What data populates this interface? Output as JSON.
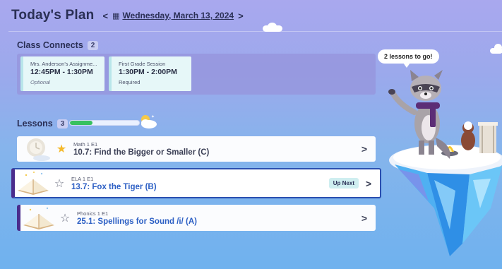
{
  "header": {
    "title": "Today's Plan",
    "prev_glyph": "<",
    "next_glyph": ">",
    "calendar_glyph": "▦",
    "date": "Wednesday, March 13, 2024"
  },
  "class_connects": {
    "title": "Class Connects",
    "count": "2",
    "cards": [
      {
        "who": "Mrs. Anderson's Assignme...",
        "time": "12:45PM - 1:30PM",
        "requirement": "Optional"
      },
      {
        "who": "First Grade Session",
        "time": "1:30PM - 2:00PM",
        "requirement": "Required"
      }
    ]
  },
  "lessons": {
    "title": "Lessons",
    "count": "3",
    "progress_fraction": 0.33,
    "items": [
      {
        "subject": "Math 1 E1",
        "name": "10.7: Find the Bigger or Smaller (C)",
        "star": "★",
        "chevron": ">"
      },
      {
        "subject": "ELA 1 E1",
        "name": "13.7: Fox the Tiger (B)",
        "star": "☆",
        "badge": "Up Next",
        "chevron": ">"
      },
      {
        "subject": "Phonics 1 E1",
        "name": "25.1: Spellings for Sound /i/ (A)",
        "star": "☆",
        "chevron": ">"
      }
    ]
  },
  "mascot": {
    "speech": "2 lessons to go!"
  },
  "colors": {
    "active_border": "#2a4fb0",
    "progress": "#38c15f",
    "star_gold": "#f5b92b",
    "accent_purple": "#4a2c8c"
  }
}
